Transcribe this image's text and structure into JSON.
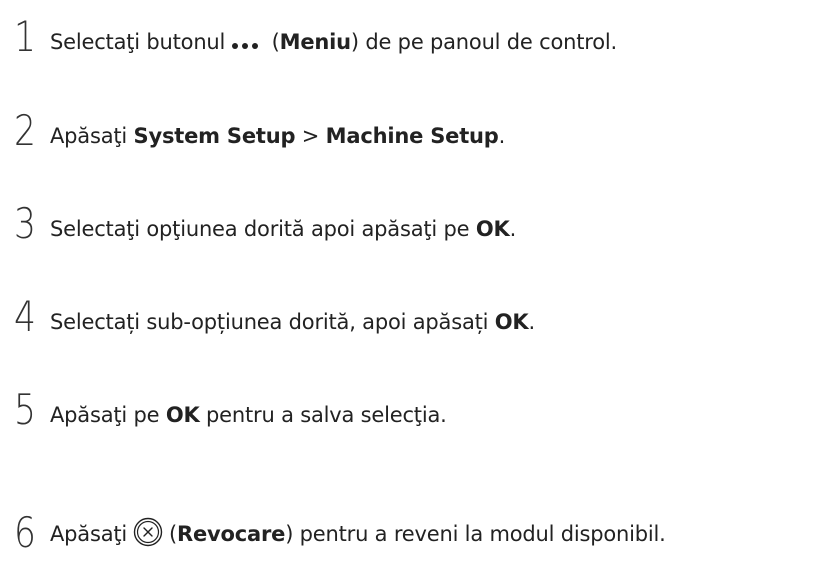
{
  "steps": [
    {
      "number": "1",
      "pre": "Selectaţi butonul",
      "icon": "more-dots-icon",
      "mid": " (",
      "bold": "Meniu",
      "post": ") de pe panoul de control."
    },
    {
      "number": "2",
      "pre": "Apăsaţi ",
      "bold1": "System Setup",
      "sep": " > ",
      "bold2": "Machine Setup",
      "post": "."
    },
    {
      "number": "3",
      "pre": "Selectaţi opţiunea dorită apoi apăsaţi pe ",
      "bold": "OK",
      "post": "."
    },
    {
      "number": "4",
      "pre": "Selectați sub-opțiunea dorită, apoi apăsați ",
      "bold": "OK",
      "post": "."
    },
    {
      "number": "5",
      "pre": "Apăsaţi pe ",
      "bold": "OK",
      "post": " pentru a salva selecţia."
    },
    {
      "number": "6",
      "pre": "Apăsaţi",
      "icon": "cancel-icon",
      "mid": "(",
      "bold": "Revocare",
      "post": ") pentru a reveni la modul disponibil."
    }
  ]
}
